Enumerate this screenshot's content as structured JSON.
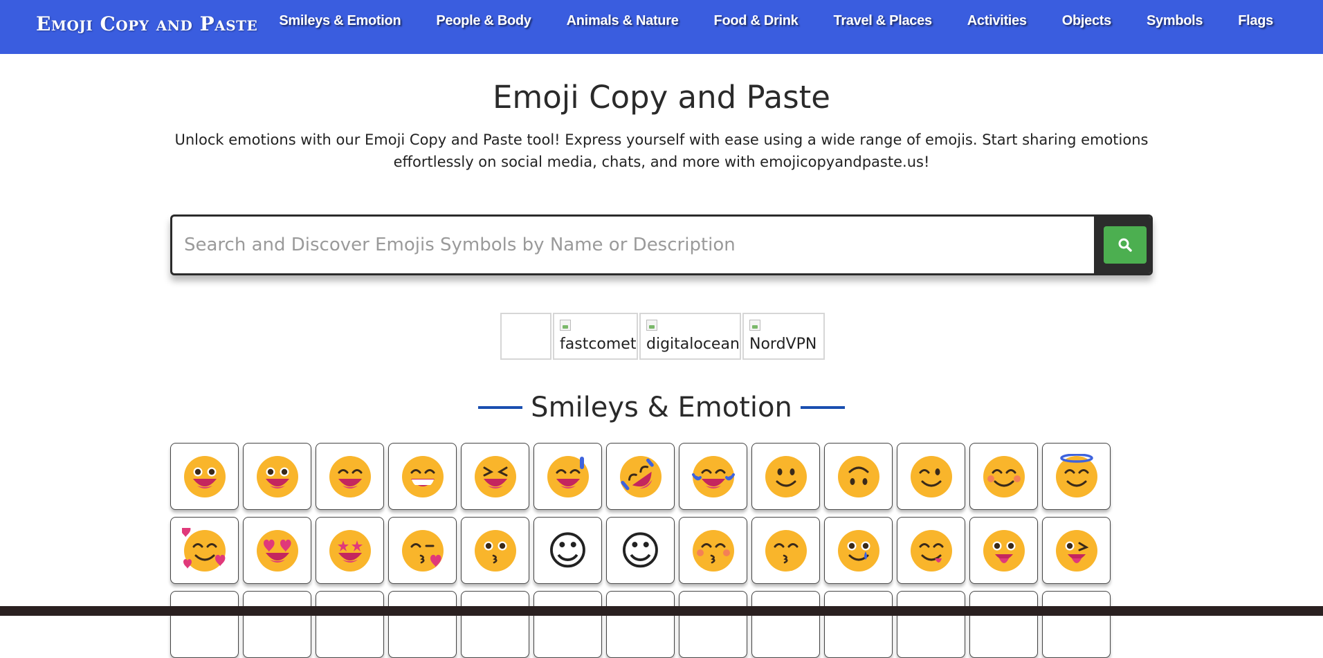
{
  "header": {
    "brand": "Emoji Copy and Paste",
    "nav": [
      "Smileys & Emotion",
      "People & Body",
      "Animals & Nature",
      "Food & Drink",
      "Travel & Places",
      "Activities",
      "Objects",
      "Symbols",
      "Flags"
    ]
  },
  "main": {
    "title": "Emoji Copy and Paste",
    "intro": "Unlock emotions with our Emoji Copy and Paste tool! Express yourself with ease using a wide range of emojis. Start sharing emotions effortlessly on social media, chats, and more with emojicopyandpaste.us!"
  },
  "search": {
    "placeholder": "Search and Discover Emojis Symbols by Name or Description",
    "value": "",
    "button_icon": "search-icon",
    "button_color": "#4caf50"
  },
  "sponsors": [
    "",
    "fastcomet",
    "digitalocean",
    "NordVPN"
  ],
  "section": {
    "title": "Smileys & Emotion",
    "accent_color": "#1a4fb0"
  },
  "emoji_rows": [
    [
      "grinning-face",
      "grinning-face-with-big-eyes",
      "grinning-face-with-smiling-eyes",
      "beaming-face-with-smiling-eyes",
      "grinning-squinting-face",
      "grinning-face-with-sweat",
      "rolling-on-the-floor-laughing",
      "face-with-tears-of-joy",
      "slightly-smiling-face",
      "upside-down-face",
      "winking-face",
      "smiling-face-with-smiling-eyes",
      "smiling-face-with-halo"
    ],
    [
      "smiling-face-with-hearts",
      "smiling-face-with-heart-eyes",
      "star-struck",
      "face-blowing-a-kiss",
      "kissing-face",
      "☺",
      "☺",
      "kissing-face-with-closed-eyes",
      "kissing-face-with-smiling-eyes",
      "smiling-face-with-tear",
      "face-savoring-food",
      "face-with-tongue",
      "winking-face-with-tongue"
    ],
    [
      "",
      "",
      "",
      "",
      "",
      "",
      "",
      "",
      "",
      "",
      "",
      "",
      ""
    ]
  ],
  "colors": {
    "header_bg": "#3a5ddf",
    "emoji_yellow": "#f9b52b",
    "tongue_pink": "#e0397a",
    "blue_accent": "#3e63dd"
  }
}
